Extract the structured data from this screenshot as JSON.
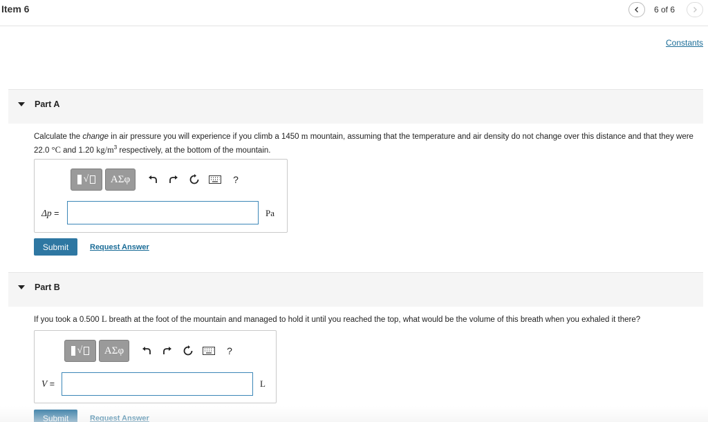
{
  "header": {
    "item_title": "Item 6",
    "nav_count": "6 of 6",
    "prev_icon": "chevron-left-icon",
    "next_icon": "chevron-right-icon"
  },
  "constants_link": "Constants",
  "parts": [
    {
      "title": "Part A",
      "question": {
        "t1": "Calculate the ",
        "t_em": "change",
        "t2": " in air pressure you will experience if you climb a 1450 ",
        "unit_m": "m",
        "t3": " mountain, assuming that the temperature and air density do not change over this distance and that they were 22.0 ",
        "unit_temp": "°C",
        "t4": " and 1.20 ",
        "unit_density": "kg/m",
        "unit_density_exp": "3",
        "t5": " respectively, at the bottom of the mountain."
      },
      "toolbar": {
        "greek": "ΑΣφ",
        "help": "?"
      },
      "variable": "Δp",
      "equals": " =",
      "input_value": "",
      "unit": "Pa",
      "submit_label": "Submit",
      "request_label": "Request Answer"
    },
    {
      "title": "Part B",
      "question": {
        "t1": "If you took a 0.500 ",
        "unit_l": "L",
        "t2": " breath at the foot of the mountain and managed to hold it until you reached the top, what would be the volume of this breath when you exhaled it there?"
      },
      "toolbar": {
        "greek": "ΑΣφ",
        "help": "?"
      },
      "variable": "V",
      "equals": " =",
      "input_value": "",
      "unit": "L",
      "submit_label": "Submit",
      "request_label": "Request Answer"
    }
  ],
  "colors": {
    "accent": "#2e77a2",
    "link": "#1a6c97",
    "input_border": "#3a86b7",
    "band": "#f5f5f5"
  }
}
